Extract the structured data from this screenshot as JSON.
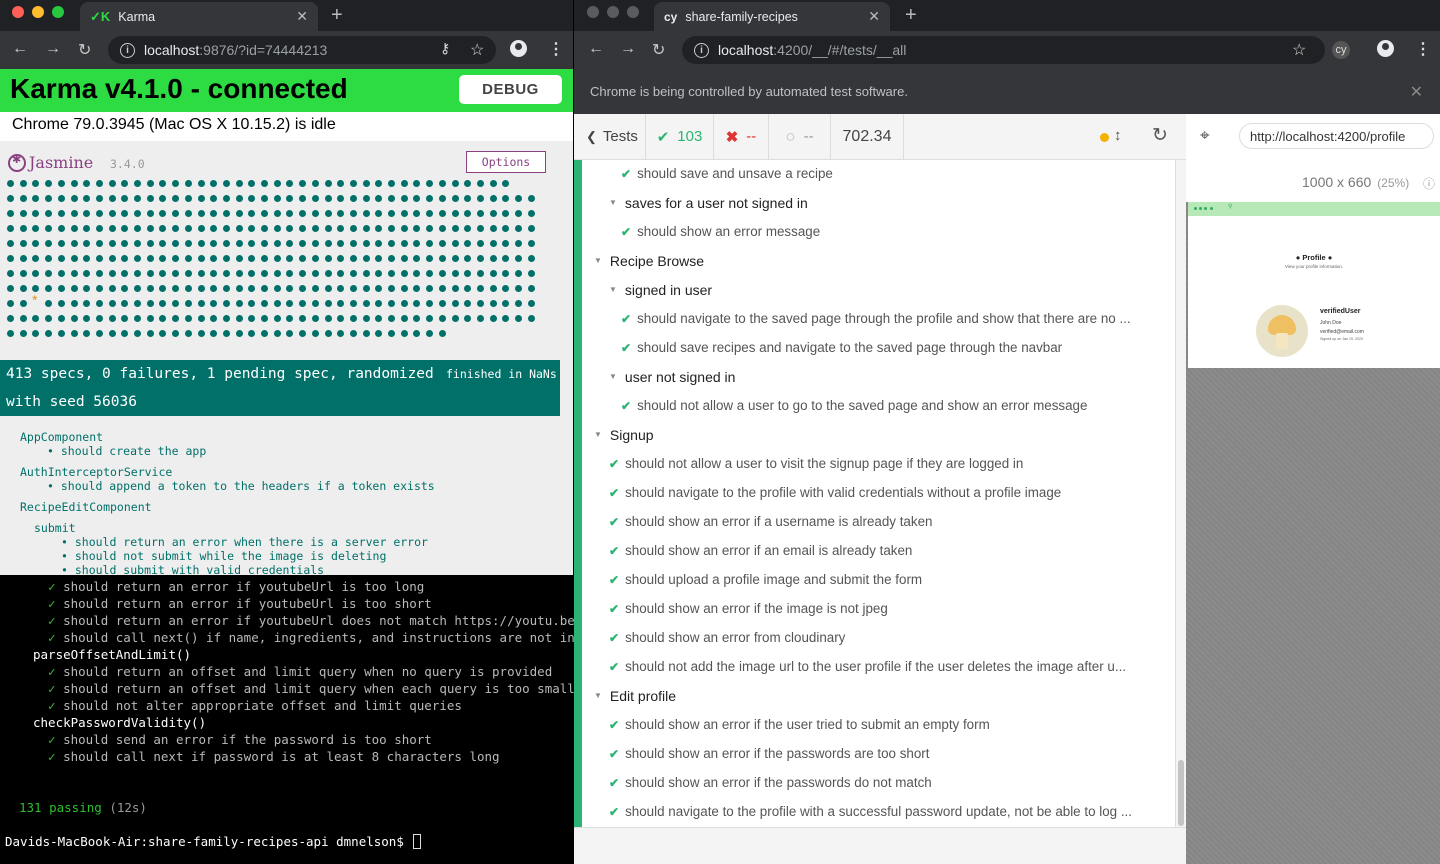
{
  "terminal": {
    "lines": [
      {
        "indent": "    ",
        "check": true,
        "text": "should return an error if youtubeUrl is too long"
      },
      {
        "indent": "    ",
        "check": true,
        "text": "should return an error if youtubeUrl is too short"
      },
      {
        "indent": "    ",
        "check": true,
        "text": "should return an error if youtubeUrl does not match https://youtu.be/"
      },
      {
        "indent": "    ",
        "check": true,
        "text": "should call next() if name, ingredients, and instructions are not included"
      },
      {
        "indent": "  ",
        "check": false,
        "text": "parseOffsetAndLimit()"
      },
      {
        "indent": "    ",
        "check": true,
        "text": "should return an offset and limit query when no query is provided"
      },
      {
        "indent": "    ",
        "check": true,
        "text": "should return an offset and limit query when each query is too small"
      },
      {
        "indent": "    ",
        "check": true,
        "text": "should not alter appropriate offset and limit queries"
      },
      {
        "indent": "  ",
        "check": false,
        "text": "checkPasswordValidity()"
      },
      {
        "indent": "    ",
        "check": true,
        "text": "should send an error if the password is too short"
      },
      {
        "indent": "    ",
        "check": true,
        "text": "should call next if password is at least 8 characters long"
      }
    ],
    "passing": "131 passing",
    "passing_time": "(12s)",
    "prompt": "Davids-MacBook-Air:share-family-recipes-api dmnelson$ "
  },
  "left_browser": {
    "tab_title": "Karma",
    "url_host": "localhost",
    "url_path": ":9876/?id=74444213",
    "karma_title": "Karma v4.1.0 - connected",
    "debug_label": "DEBUG",
    "status": "Chrome 79.0.3945 (Mac OS X 10.15.2) is idle",
    "jasmine_name": "Jasmine",
    "jasmine_version": "3.4.0",
    "options_label": "Options",
    "summary_line1": "413 specs, 0 failures, 1 pending spec, randomized",
    "summary_line2": "with seed 56036",
    "summary_time": "finished in NaNs",
    "specs": [
      {
        "level": 0,
        "text": "AppComponent"
      },
      {
        "level": 1,
        "text": "• should create the app"
      },
      {
        "level": 0,
        "text": "AuthInterceptorService"
      },
      {
        "level": 1,
        "text": "• should append a token to the headers if a token exists"
      },
      {
        "level": 0,
        "text": "RecipeEditComponent"
      },
      {
        "level": 1,
        "text": "submit"
      },
      {
        "level": 2,
        "text": "• should return an error when there is a server error"
      },
      {
        "level": 2,
        "text": "• should not submit while the image is deleting"
      },
      {
        "level": 2,
        "text": "• should submit with valid credentials"
      }
    ]
  },
  "right_browser": {
    "tab_icon": "cy",
    "tab_title": "share-family-recipes",
    "url_host": "localhost",
    "url_path": ":4200/__/#/tests/__all",
    "automation_notice": "Chrome is being controlled by automated test software.",
    "tests_label": "Tests",
    "passed": "103",
    "failed": "--",
    "pending": "--",
    "duration": "702.34",
    "aut_url": "http://localhost:4200/profile",
    "viewport": "1000 x 660",
    "viewport_pct": "(25%)",
    "tests": [
      {
        "type": "test",
        "level": 2,
        "text": "should save and unsave a recipe"
      },
      {
        "type": "suite",
        "level": 1,
        "text": "saves for a user not signed in"
      },
      {
        "type": "test",
        "level": 2,
        "text": "should show an error message"
      },
      {
        "type": "suite",
        "level": 0,
        "text": "Recipe Browse"
      },
      {
        "type": "suite",
        "level": 1,
        "text": "signed in user"
      },
      {
        "type": "test",
        "level": 2,
        "text": "should navigate to the saved page through the profile and show that there are no ..."
      },
      {
        "type": "test",
        "level": 2,
        "text": "should save recipes and navigate to the saved page through the navbar"
      },
      {
        "type": "suite",
        "level": 1,
        "text": "user not signed in"
      },
      {
        "type": "test",
        "level": 2,
        "text": "should not allow a user to go to the saved page and show an error message"
      },
      {
        "type": "suite",
        "level": 0,
        "text": "Signup"
      },
      {
        "type": "test",
        "level": 1,
        "text": "should not allow a user to visit the signup page if they are logged in"
      },
      {
        "type": "test",
        "level": 1,
        "text": "should navigate to the profile with valid credentials without a profile image"
      },
      {
        "type": "test",
        "level": 1,
        "text": "should show an error if a username is already taken"
      },
      {
        "type": "test",
        "level": 1,
        "text": "should show an error if an email is already taken"
      },
      {
        "type": "test",
        "level": 1,
        "text": "should upload a profile image and submit the form"
      },
      {
        "type": "test",
        "level": 1,
        "text": "should show an error if the image is not jpeg"
      },
      {
        "type": "test",
        "level": 1,
        "text": "should show an error from cloudinary"
      },
      {
        "type": "test",
        "level": 1,
        "text": "should not add the image url to the user profile if the user deletes the image after u..."
      },
      {
        "type": "suite",
        "level": 0,
        "text": "Edit profile"
      },
      {
        "type": "test",
        "level": 1,
        "text": "should show an error if the user tried to submit an empty form"
      },
      {
        "type": "test",
        "level": 1,
        "text": "should show an error if the passwords are too short"
      },
      {
        "type": "test",
        "level": 1,
        "text": "should show an error if the passwords do not match"
      },
      {
        "type": "test",
        "level": 1,
        "text": "should navigate to the profile with a successful password update, not be able to log ..."
      }
    ],
    "aut": {
      "page_title": "Profile",
      "page_subtitle": "View your profile information.",
      "username": "verifiedUser",
      "name": "John Doe",
      "email": "verified@email.com",
      "signed_up": "Signed up on Jan 19, 2020"
    }
  },
  "colors": {
    "karma_green": "#2ddc43",
    "jasmine_teal": "#007069",
    "jasmine_purple": "#8a4182",
    "cypress_pass": "#2bb573",
    "cypress_fail": "#dd3333"
  }
}
